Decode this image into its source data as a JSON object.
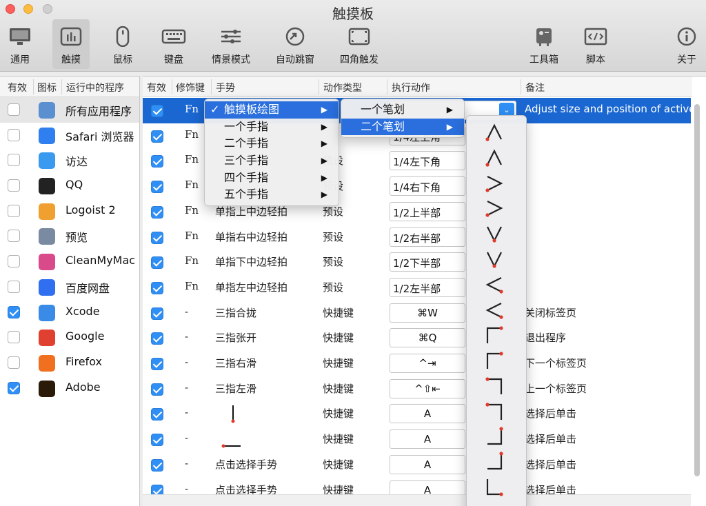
{
  "window": {
    "title": "触摸板"
  },
  "toolbar": [
    {
      "label": "通用",
      "icon": "monitor-icon"
    },
    {
      "label": "触摸",
      "icon": "trackpad-icon",
      "active": true
    },
    {
      "label": "鼠标",
      "icon": "mouse-icon"
    },
    {
      "label": "键盘",
      "icon": "keyboard-icon"
    },
    {
      "label": "情景模式",
      "icon": "sliders-icon"
    },
    {
      "label": "自动跳窗",
      "icon": "jump-window-icon"
    },
    {
      "label": "四角触发",
      "icon": "corners-icon"
    },
    {
      "label": "工具箱",
      "icon": "toolbox-icon"
    },
    {
      "label": "脚本",
      "icon": "script-icon"
    },
    {
      "label": "关于",
      "icon": "info-icon"
    }
  ],
  "apps": {
    "headers": {
      "enabled": "有效",
      "icon": "图标",
      "running": "运行中的程序"
    },
    "items": [
      {
        "name": "所有应用程序",
        "checked": false,
        "icon": "all-apps-icon",
        "color": "#5a8fd0",
        "selected": true
      },
      {
        "name": "Safari 浏览器",
        "checked": false,
        "icon": "safari-icon",
        "color": "#2f7ff0"
      },
      {
        "name": "访达",
        "checked": false,
        "icon": "finder-icon",
        "color": "#3a9af0"
      },
      {
        "name": "QQ",
        "checked": false,
        "icon": "qq-icon",
        "color": "#222222"
      },
      {
        "name": "Logoist 2",
        "checked": false,
        "icon": "logoist-icon",
        "color": "#f0a030"
      },
      {
        "name": "预览",
        "checked": false,
        "icon": "preview-icon",
        "color": "#7a8aa0"
      },
      {
        "name": "CleanMyMac",
        "checked": false,
        "icon": "cleanmymac-icon",
        "color": "#d84a8a"
      },
      {
        "name": "百度网盘",
        "checked": false,
        "icon": "baidu-netdisk-icon",
        "color": "#2f6ff0"
      },
      {
        "name": "Xcode",
        "checked": true,
        "icon": "xcode-icon",
        "color": "#3a8ae8"
      },
      {
        "name": "Google",
        "checked": false,
        "icon": "chrome-icon",
        "color": "#e04030"
      },
      {
        "name": "Firefox",
        "checked": false,
        "icon": "firefox-icon",
        "color": "#f07020"
      },
      {
        "name": "Adobe",
        "checked": true,
        "icon": "adobe-illustrator-icon",
        "color": "#2a1a08"
      }
    ]
  },
  "gestures": {
    "headers": {
      "enabled": "有效",
      "modifier": "修饰键",
      "gesture": "手势",
      "type": "动作类型",
      "action": "执行动作",
      "note": "备注"
    },
    "rows": [
      {
        "checked": true,
        "modifier": "Fn",
        "gesture": "",
        "type": "",
        "action": "",
        "note": "Adjust size and position of active",
        "selected": true
      },
      {
        "checked": true,
        "modifier": "Fn",
        "gesture": "",
        "type": "",
        "action": "1/4左上角",
        "note": ""
      },
      {
        "checked": true,
        "modifier": "Fn",
        "gesture": "",
        "type": "预设",
        "action": "1/4左下角",
        "note": ""
      },
      {
        "checked": true,
        "modifier": "Fn",
        "gesture": "",
        "type": "预设",
        "action": "1/4右下角",
        "note": ""
      },
      {
        "checked": true,
        "modifier": "Fn",
        "gesture": "单指上中边轻拍",
        "type": "预设",
        "action": "1/2上半部",
        "note": ""
      },
      {
        "checked": true,
        "modifier": "Fn",
        "gesture": "单指右中边轻拍",
        "type": "预设",
        "action": "1/2右半部",
        "note": ""
      },
      {
        "checked": true,
        "modifier": "Fn",
        "gesture": "单指下中边轻拍",
        "type": "预设",
        "action": "1/2下半部",
        "note": ""
      },
      {
        "checked": true,
        "modifier": "Fn",
        "gesture": "单指左中边轻拍",
        "type": "预设",
        "action": "1/2左半部",
        "note": ""
      },
      {
        "checked": true,
        "modifier": "-",
        "gesture": "三指合拢",
        "type": "快捷键",
        "action": "⌘W",
        "note": "关闭标签页"
      },
      {
        "checked": true,
        "modifier": "-",
        "gesture": "三指张开",
        "type": "快捷键",
        "action": "⌘Q",
        "note": "退出程序"
      },
      {
        "checked": true,
        "modifier": "-",
        "gesture": "三指右滑",
        "type": "快捷键",
        "action": "^⇥",
        "note": "下一个标签页"
      },
      {
        "checked": true,
        "modifier": "-",
        "gesture": "三指左滑",
        "type": "快捷键",
        "action": "^⇧⇤",
        "note": "上一个标签页"
      },
      {
        "checked": true,
        "modifier": "-",
        "gesture": "",
        "type": "快捷键",
        "action": "A",
        "note": "选择后单击",
        "drawing": "vertical"
      },
      {
        "checked": true,
        "modifier": "-",
        "gesture": "",
        "type": "快捷键",
        "action": "A",
        "note": "选择后单击",
        "drawing": "horizontal"
      },
      {
        "checked": true,
        "modifier": "-",
        "gesture": "点击选择手势",
        "type": "快捷键",
        "action": "A",
        "note": "选择后单击"
      },
      {
        "checked": true,
        "modifier": "-",
        "gesture": "点击选择手势",
        "type": "快捷键",
        "action": "A",
        "note": "选择后单击"
      }
    ]
  },
  "menu1": {
    "items": [
      {
        "label": "触摸板绘图",
        "checked": true,
        "highlight": true
      },
      {
        "label": "一个手指"
      },
      {
        "label": "二个手指"
      },
      {
        "label": "三个手指"
      },
      {
        "label": "四个手指"
      },
      {
        "label": "五个手指"
      }
    ]
  },
  "menu2": {
    "items": [
      {
        "label": "一个笔划"
      },
      {
        "label": "二个笔划",
        "highlight": true
      }
    ]
  },
  "menu3": {
    "shapes": [
      "caret-up",
      "caret-up",
      "caret-right",
      "caret-right",
      "caret-down",
      "caret-down",
      "caret-left",
      "caret-left",
      "corner-top-left",
      "corner-top-left",
      "corner-top-right",
      "corner-top-right",
      "corner-bottom-right",
      "corner-bottom-right",
      "corner-bottom-left"
    ]
  },
  "colors": {
    "accent": "#1a67d2",
    "menu_highlight": "#2a6fdd",
    "dot": "#e0392b"
  }
}
